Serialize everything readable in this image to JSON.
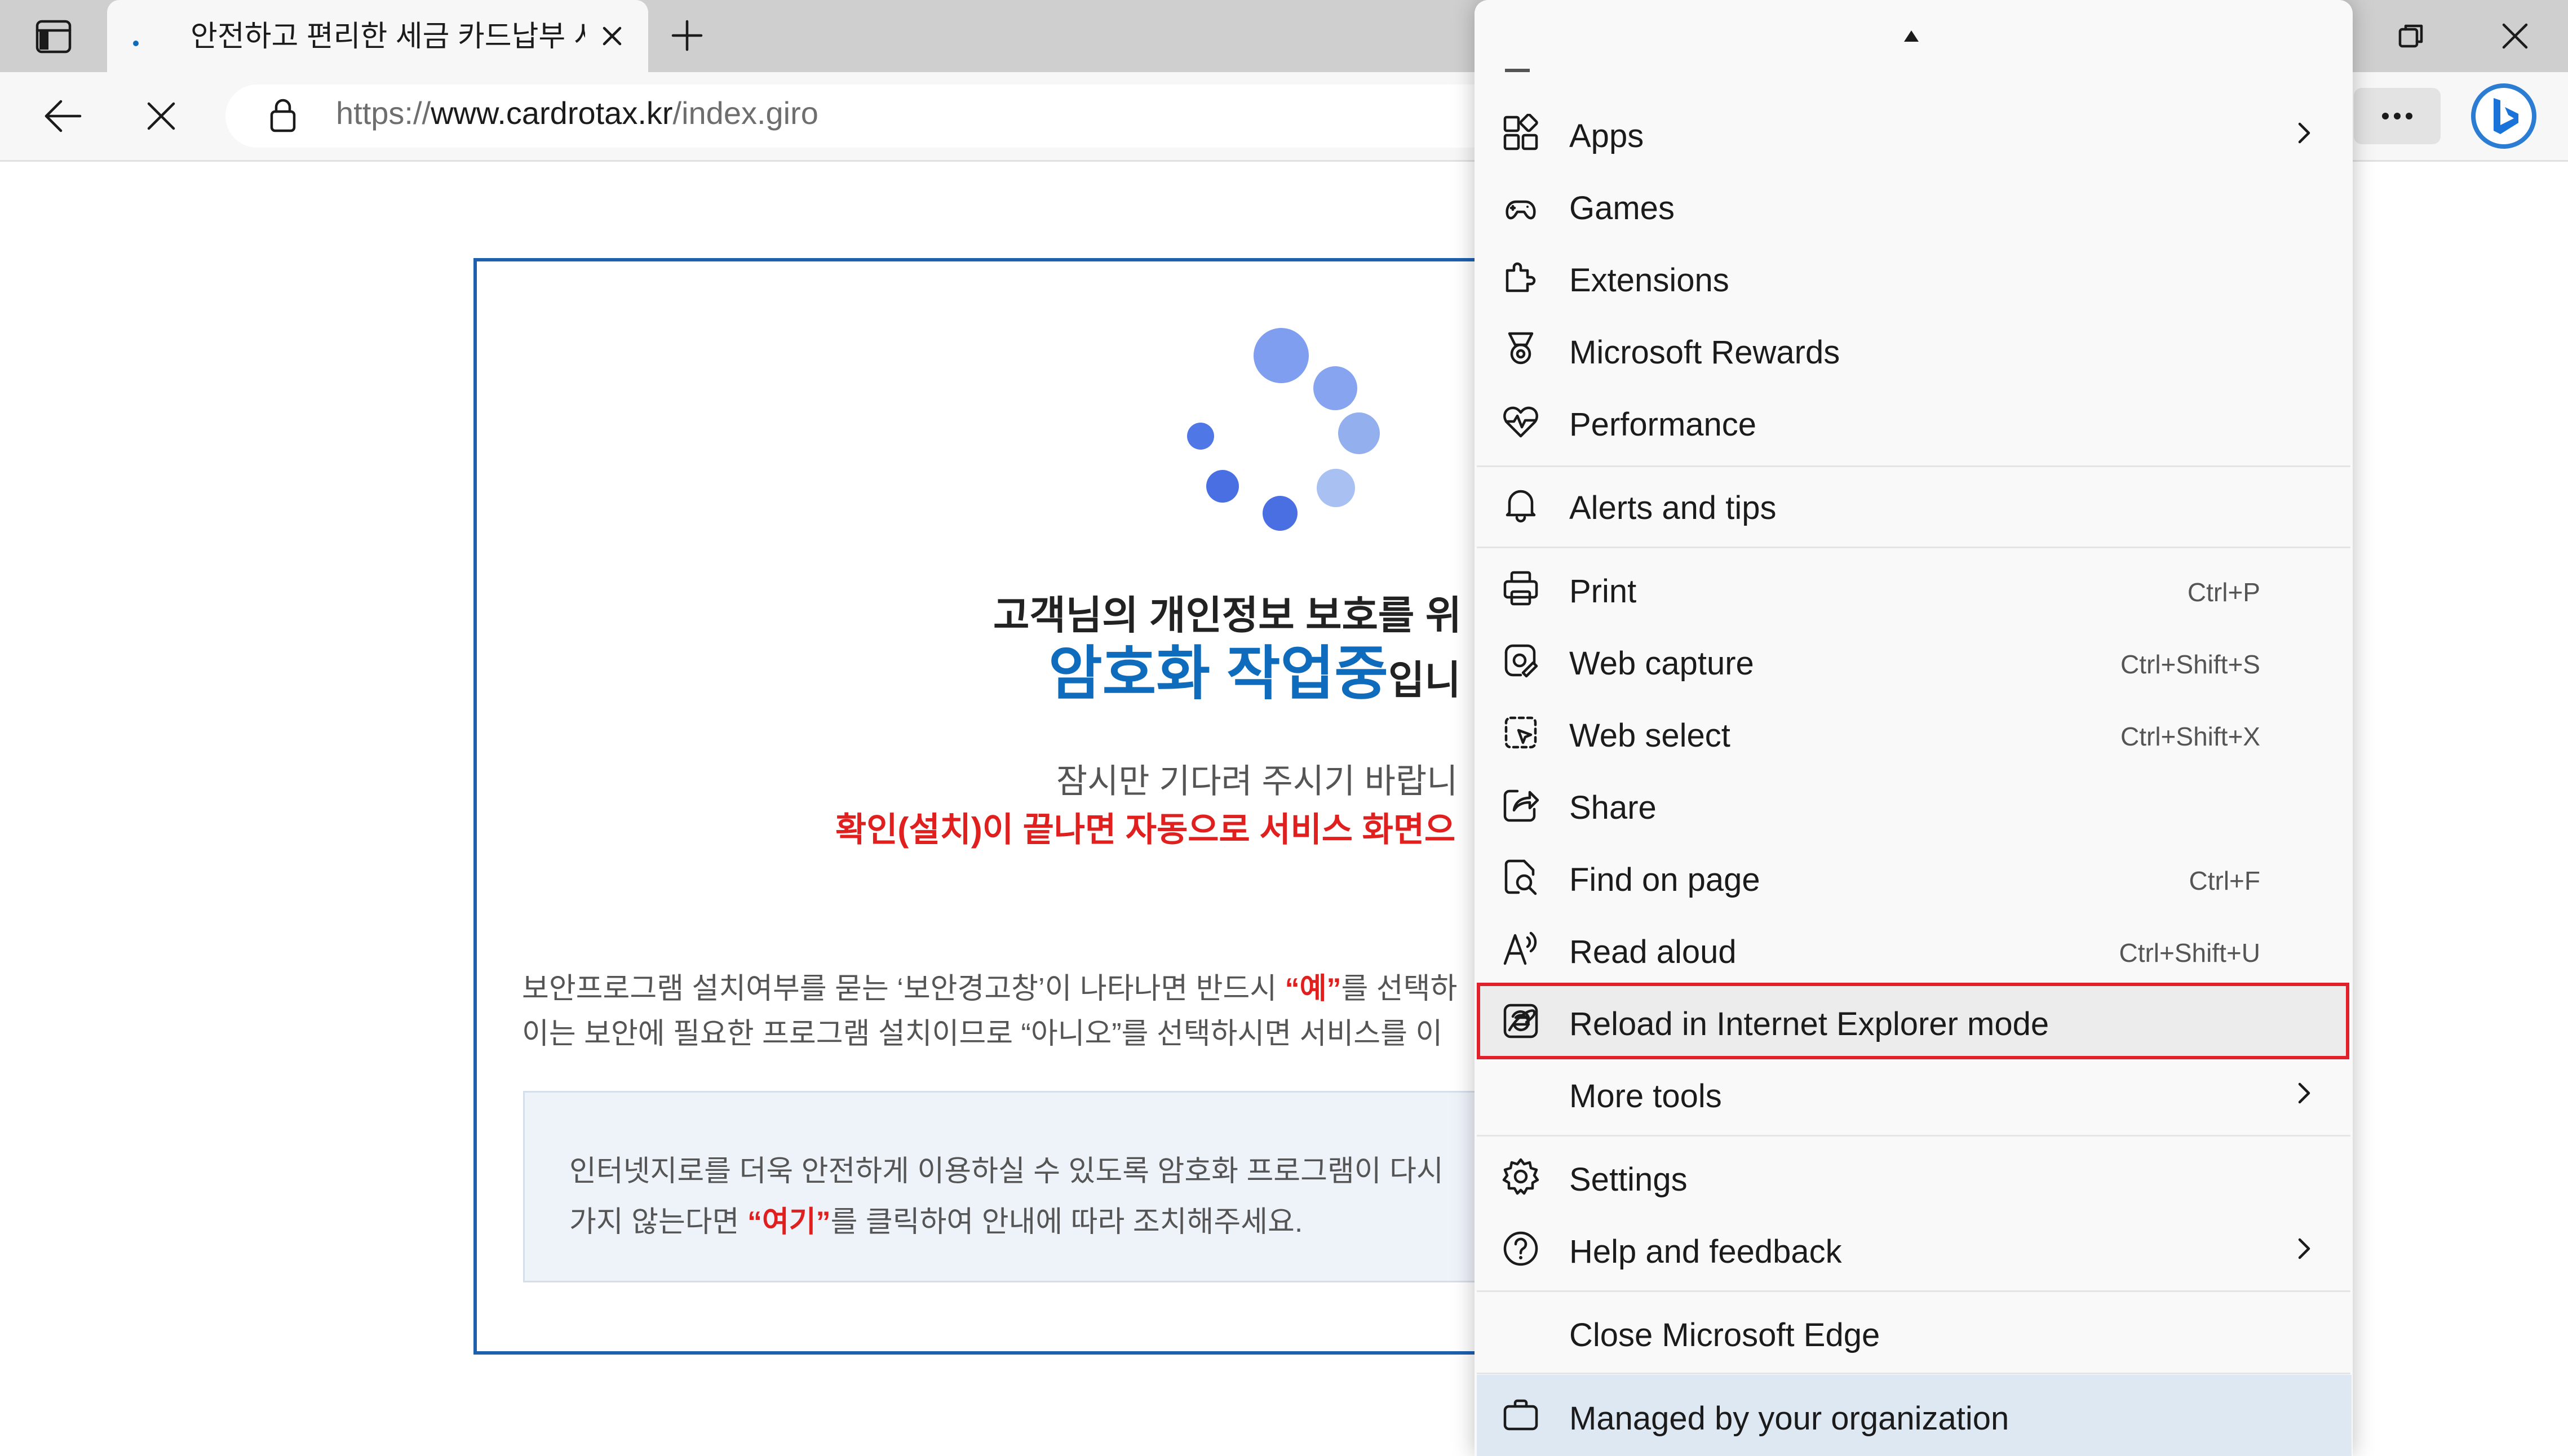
{
  "browser": {
    "tab_title": "안전하고 편리한 세금 카드납부 서비스",
    "url_prefix": "https://",
    "url_host": "www.cardrotax.kr",
    "url_path": "/index.giro"
  },
  "page": {
    "heading_line1": "고객님의 개인정보 보호를 위",
    "heading_blue": "암호화 작업중",
    "heading_suffix": "입니",
    "wait_text": "잠시만 기다려 주시기 바랍니",
    "red_notice": "확인(설치)이 끝나면 자동으로 서비스 화면으",
    "para1_a": "보안프로그램 설치여부를 묻는 ‘보안경고창’이 나타나면 반드시 ",
    "para1_red": "“예”",
    "para1_b": "를 선택하",
    "para2": "이는 보안에 필요한 프로그램 설치이므로 “아니오”를 선택하시면 서비스를 이",
    "info_line1": "인터넷지로를 더욱 안전하게 이용하실 수 있도록 암호화 프로그램이 다시",
    "info_line2_a": "가지 않는다면 ",
    "info_line2_red": "“여기”",
    "info_line2_b": "를 클릭하여 안내에 따라 조치해주세요."
  },
  "menu": {
    "items": [
      {
        "label": "Apps",
        "shortcut": ""
      },
      {
        "label": "Games",
        "shortcut": ""
      },
      {
        "label": "Extensions",
        "shortcut": ""
      },
      {
        "label": "Microsoft Rewards",
        "shortcut": ""
      },
      {
        "label": "Performance",
        "shortcut": ""
      },
      {
        "label": "Alerts and tips",
        "shortcut": ""
      },
      {
        "label": "Print",
        "shortcut": "Ctrl+P"
      },
      {
        "label": "Web capture",
        "shortcut": "Ctrl+Shift+S"
      },
      {
        "label": "Web select",
        "shortcut": "Ctrl+Shift+X"
      },
      {
        "label": "Share",
        "shortcut": ""
      },
      {
        "label": "Find on page",
        "shortcut": "Ctrl+F"
      },
      {
        "label": "Read aloud",
        "shortcut": "Ctrl+Shift+U"
      },
      {
        "label": "Reload in Internet Explorer mode",
        "shortcut": ""
      },
      {
        "label": "More tools",
        "shortcut": ""
      },
      {
        "label": "Settings",
        "shortcut": ""
      },
      {
        "label": "Help and feedback",
        "shortcut": ""
      },
      {
        "label": "Close Microsoft Edge",
        "shortcut": ""
      },
      {
        "label": "Managed by your organization",
        "shortcut": ""
      }
    ]
  },
  "colors": {
    "accent_blue": "#0f6cbd",
    "notice_red": "#e0201e",
    "highlight_border": "#e0202a"
  }
}
